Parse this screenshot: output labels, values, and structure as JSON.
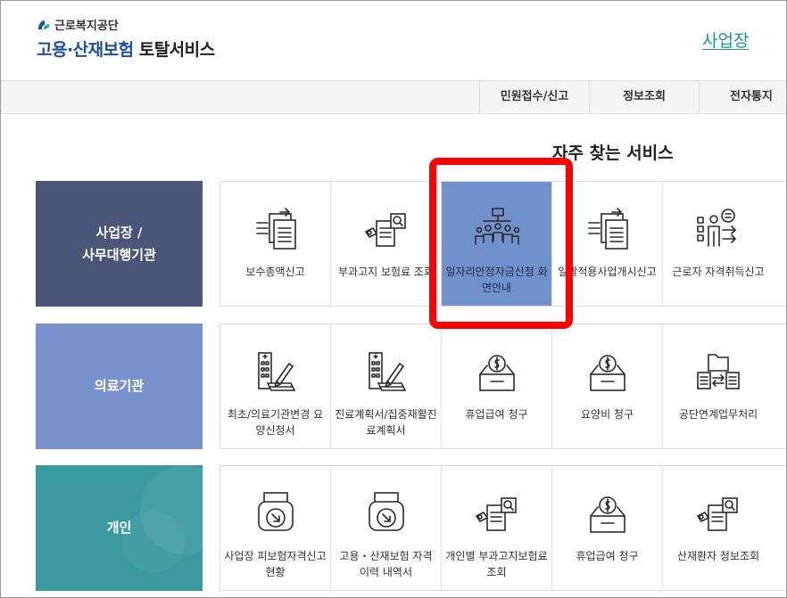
{
  "header": {
    "org_name": "근로복지공단",
    "service_title_accent": "고용·산재보험",
    "service_title_rest": " 토탈서비스",
    "workplace_link": "사업장"
  },
  "nav": {
    "items": [
      "민원접수/신고",
      "정보조회",
      "전자통지"
    ]
  },
  "section": {
    "heading": "자주 찾는 서비스"
  },
  "categories": [
    {
      "label": "사업장 /\n사무대행기관"
    },
    {
      "label": "의료기관"
    },
    {
      "label": "개인"
    }
  ],
  "rows": [
    {
      "tiles": [
        {
          "label": "보수총액신고",
          "icon": "document-arrow-icon"
        },
        {
          "label": "부과고지 보험료 조회",
          "icon": "document-search-icon"
        },
        {
          "label": "일자리안정자금신청 화면안내",
          "icon": "group-people-icon",
          "highlighted": true
        },
        {
          "label": "일괄적용사업개시신고",
          "icon": "document-arrow-icon"
        },
        {
          "label": "근로자 자격취득신고",
          "icon": "person-checklist-icon"
        }
      ]
    },
    {
      "tiles": [
        {
          "label": "최초/의료기관변경 요양신청서",
          "icon": "hospital-pen-icon"
        },
        {
          "label": "진료계획서/집중재활진료계획서",
          "icon": "hospital-pen-icon"
        },
        {
          "label": "휴업급여 청구",
          "icon": "money-box-icon"
        },
        {
          "label": "요양비 청구",
          "icon": "money-box-icon"
        },
        {
          "label": "공단연계업무처리",
          "icon": "folder-exchange-icon"
        }
      ]
    },
    {
      "tiles": [
        {
          "label": "사업장 피보험자격신고현황",
          "icon": "printer-arrow-icon"
        },
        {
          "label": "고용・산재보험 자격 이력 내역서",
          "icon": "printer-arrow-icon"
        },
        {
          "label": "개인별 부과고지보험료 조회",
          "icon": "document-search-icon"
        },
        {
          "label": "휴업급여 청구",
          "icon": "money-box-icon"
        },
        {
          "label": "산재환자 정보조회",
          "icon": "document-search-icon"
        }
      ]
    }
  ],
  "colors": {
    "brand_blue": "#1a4f9c",
    "workplace_link": "#1a9a93",
    "category_workplace": "#4a5577",
    "category_medical": "#7792cc",
    "category_personal": "#3a9aa0",
    "highlight_tile": "#7191cc",
    "annotation_red": "#ff0000"
  }
}
